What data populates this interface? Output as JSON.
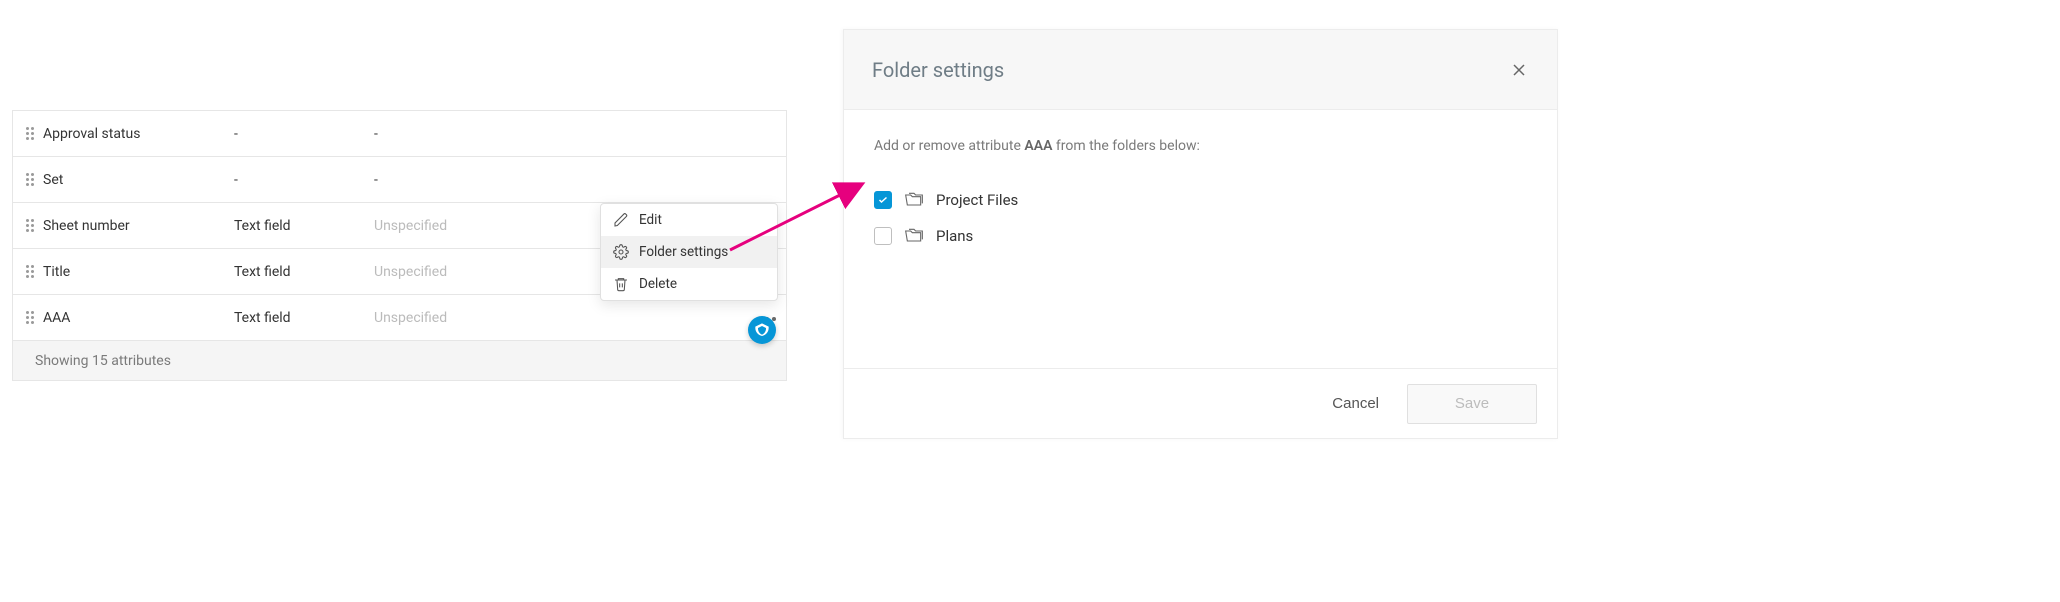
{
  "table": {
    "rows": [
      {
        "name": "Approval status",
        "type": "-",
        "req": "-"
      },
      {
        "name": "Set",
        "type": "-",
        "req": "-"
      },
      {
        "name": "Sheet number",
        "type": "Text field",
        "req": "Unspecified"
      },
      {
        "name": "Title",
        "type": "Text field",
        "req": "Unspecified"
      },
      {
        "name": "AAA",
        "type": "Text field",
        "req": "Unspecified"
      }
    ],
    "footer": "Showing 15 attributes"
  },
  "menu": {
    "edit": "Edit",
    "folder_settings": "Folder settings",
    "delete": "Delete"
  },
  "panel": {
    "title": "Folder settings",
    "instr_prefix": "Add or remove attribute ",
    "instr_attr": "AAA",
    "instr_suffix": " from the folders below:",
    "folders": [
      {
        "label": "Project Files",
        "checked": true
      },
      {
        "label": "Plans",
        "checked": false
      }
    ],
    "cancel": "Cancel",
    "save": "Save"
  }
}
